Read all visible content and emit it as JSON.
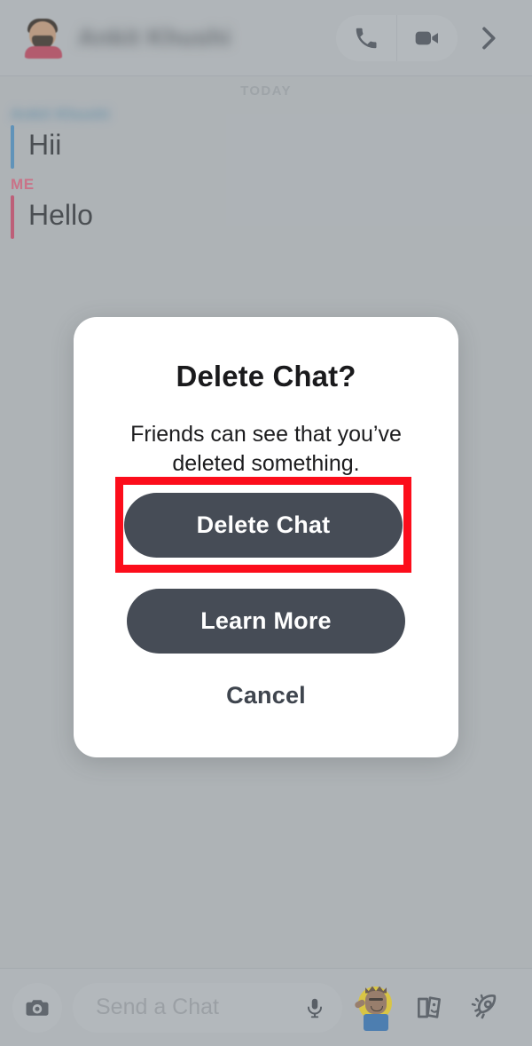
{
  "header": {
    "contact_name": "Ankit Khushi",
    "contact_name_blurred": true,
    "avatar_label": "contact-bitmoji-avatar",
    "call_icon": "phone-icon",
    "video_icon": "video-camera-icon",
    "forward_icon": "chevron-right-icon"
  },
  "conversation": {
    "day_separator": "TODAY",
    "messages": [
      {
        "sender": "Ankit Khushi",
        "sender_blurred": true,
        "direction": "incoming",
        "accent": "#4a90c4",
        "text": "Hii"
      },
      {
        "sender": "ME",
        "sender_blurred": false,
        "direction": "outgoing",
        "accent": "#cf4668",
        "text": "Hello"
      }
    ]
  },
  "composer": {
    "camera_icon": "camera-icon",
    "placeholder": "Send a Chat",
    "mic_icon": "microphone-icon",
    "bitmoji_icon": "bitmoji-avatar-icon",
    "stickers_icon": "cards-stickers-icon",
    "rocket_icon": "rocket-icon"
  },
  "dialog": {
    "title": "Delete Chat?",
    "message": "Friends can see that you’ve deleted something.",
    "primary_button": "Delete Chat",
    "secondary_button": "Learn More",
    "tertiary_button": "Cancel"
  },
  "annotation": {
    "highlight_color": "#fc0d1b",
    "highlight_target": "Delete Chat"
  },
  "colors": {
    "app_background": "#b9bdc1",
    "bar_background": "#bcc0c4",
    "button_dark": "#464c56",
    "incoming_accent": "#4a90c4",
    "outgoing_accent": "#cf4668",
    "dialog_background": "#ffffff"
  }
}
